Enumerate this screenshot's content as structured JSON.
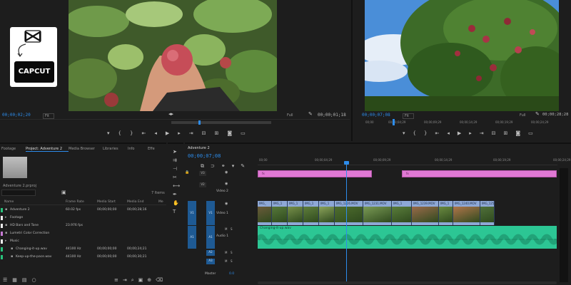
{
  "logo": {
    "top_label": "",
    "bottom_label": "CAPCUT"
  },
  "source_monitor": {
    "timecode_left": "00;00;02;20",
    "fit_label": "Fit",
    "quality_label": "Full",
    "timecode_right": "00;00;01;18",
    "ruler": []
  },
  "program_monitor": {
    "timecode_left": "00;00;07;08",
    "fit_label": "Fit",
    "quality_label": "Full",
    "timecode_right": "00;00;28;28",
    "ruler": [
      "00;00",
      "00;00;04;29",
      "00;00;09;29",
      "00;00;14;29",
      "00;00;19;29",
      "00;00;24;29"
    ]
  },
  "project_panel": {
    "tabs": [
      "Footage",
      "Project: Adventure 2",
      "Media Browser",
      "Libraries",
      "Info",
      "Effe"
    ],
    "project_name": "Adventure 2.prproj",
    "items_count": "7 Items",
    "columns": [
      "Name",
      "Frame Rate",
      "Media Start",
      "Media End",
      "Me"
    ],
    "rows": [
      {
        "name": "Adventure 2",
        "fps": "60.02 fps",
        "start": "00;00;00;00",
        "end": "00;00;28;16",
        "color": "#28c27c"
      },
      {
        "name": "Footage",
        "fps": "",
        "start": "",
        "end": "",
        "color": "#ececec"
      },
      {
        "name": "HD Bars and Tone",
        "fps": "23.976 fps",
        "start": "",
        "end": "",
        "color": "#ececec"
      },
      {
        "name": "Lumetri Color Correction",
        "fps": "",
        "start": "",
        "end": "",
        "color": "#c77ad5"
      },
      {
        "name": "Music",
        "fps": "",
        "start": "",
        "end": "",
        "color": "#ececec"
      },
      {
        "name": "Changing-it-up.wav",
        "fps": "44100 Hz",
        "start": "00;00;00;00",
        "end": "00;00;24;21",
        "color": "#28c27c"
      },
      {
        "name": "Keep-up-the-pace.wav",
        "fps": "44100 Hz",
        "start": "00;00;00;00",
        "end": "00;00;30;21",
        "color": "#28c27c"
      }
    ]
  },
  "timeline": {
    "sequence_name": "Adventure 2",
    "timecode": "00;00;07;08",
    "ruler": [
      "00;00",
      "00;00;04;29",
      "00;00;09;29",
      "00;00;14;29",
      "00;00;19;29",
      "00;00;24;29"
    ],
    "tracks": {
      "v3": "V3",
      "v2": "V2",
      "v1": "V1",
      "a1": "A1",
      "a2": "A2",
      "a3": "A3",
      "video2_label": "Video 2",
      "video1_label": "Video 1",
      "audio1_label": "Audio 1",
      "master_label": "Master",
      "master_value": "0.0"
    },
    "adjustment_clips": [
      "fx",
      "fx"
    ],
    "video_clips": [
      "IMG_",
      "IMG_1",
      "IMG_1",
      "IMG_1",
      "IMG_1",
      "IMG_1226.MOV",
      "IMG_1231.MOV",
      "IMG_1",
      "IMG_1239.MOV",
      "IMG_1",
      "IMG_1240.MOV",
      "IMG_125"
    ],
    "audio_clip": "Changing-it-up.wav"
  },
  "colors": {
    "accent": "#2d8ceb",
    "adjustment": "#e079d4",
    "audio": "#2cc694",
    "video_clip": "#8ea8d6"
  }
}
